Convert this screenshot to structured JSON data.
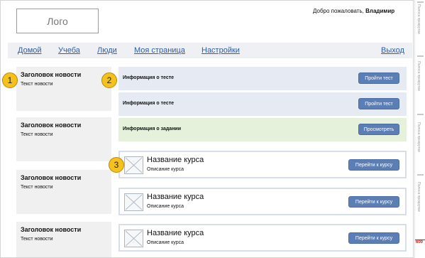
{
  "header": {
    "logo": "Лого",
    "welcome_text": "Добро пожаловать,",
    "user_name": "Владимир"
  },
  "nav": {
    "home": "Домой",
    "study": "Учеба",
    "people": "Люди",
    "my_page": "Моя страница",
    "settings": "Настройки",
    "exit": "Выход"
  },
  "news": [
    {
      "title": "Заголовок новости",
      "text": "Текст новости"
    },
    {
      "title": "Заголовок новости",
      "text": "Текст новости"
    },
    {
      "title": "Заголовок новости",
      "text": "Текст новости"
    },
    {
      "title": "Заголовок новости",
      "text": "Текст новости"
    }
  ],
  "tasks": [
    {
      "label": "Информация о тесте",
      "button": "Пройти тест"
    },
    {
      "label": "Информация о тесте",
      "button": "Пройти тест"
    },
    {
      "label": "Информация о задании",
      "button": "Просмотреть"
    }
  ],
  "courses": [
    {
      "name": "Название курса",
      "description": "Описание курса",
      "button": "Перейти к курсу"
    },
    {
      "name": "Название курса",
      "description": "Описание курса",
      "button": "Перейти к курсу"
    },
    {
      "name": "Название курса",
      "description": "Описание курса",
      "button": "Перейти к курсу"
    }
  ],
  "markers": [
    "1",
    "2",
    "3"
  ],
  "scrollbar": {
    "labels": [
      "Полоса прокрутки",
      "Полоса прокрутки",
      "Полоса прокрутки",
      "Полоса прокрутки",
      "Полоса прокрутки"
    ],
    "page_height": "600"
  },
  "colors": {
    "nav_link": "#2a5ca8",
    "button": "#5b7fb5",
    "test_row": "#e6ebf3",
    "task_row": "#e6f1dc",
    "marker": "#f5c11d"
  }
}
